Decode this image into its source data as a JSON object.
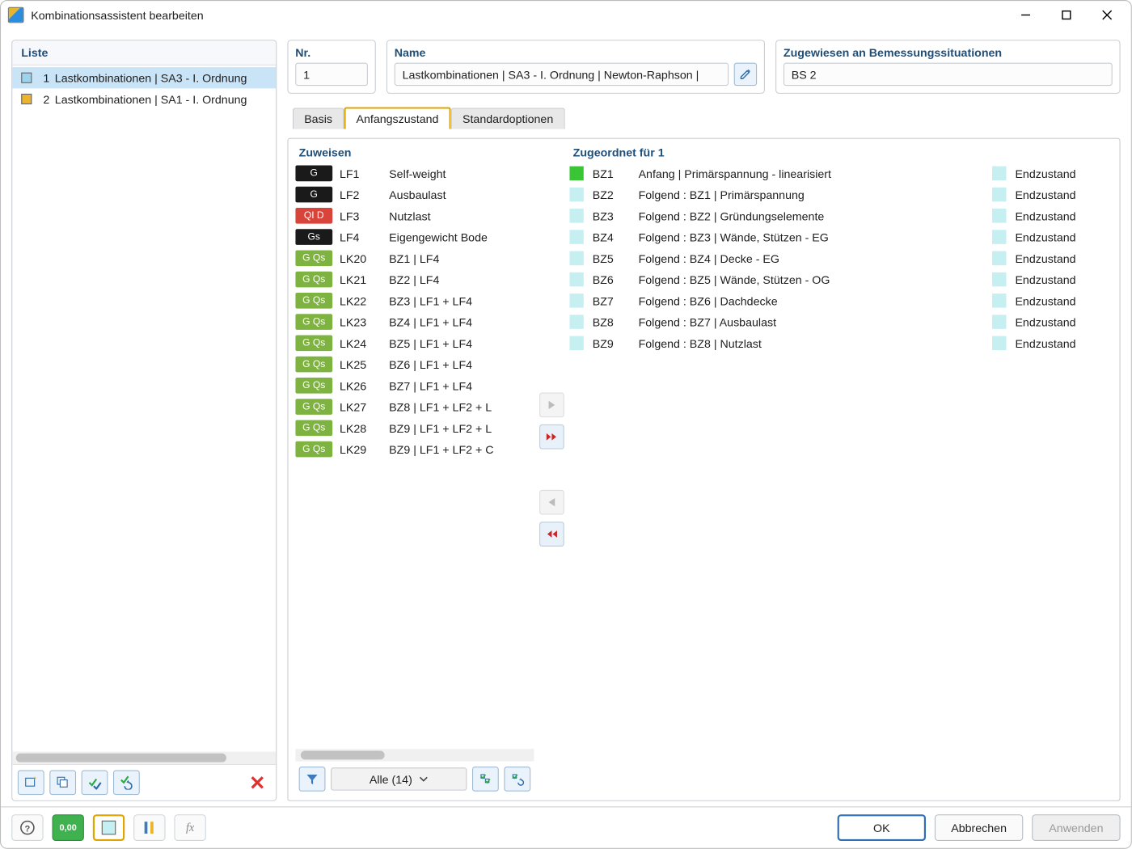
{
  "window": {
    "title": "Kombinationsassistent bearbeiten"
  },
  "listPanel": {
    "header": "Liste",
    "items": [
      {
        "idx": "1",
        "text": "Lastkombinationen | SA3 - I. Ordnung",
        "color": "#9cd4f0",
        "selected": true
      },
      {
        "idx": "2",
        "text": "Lastkombinationen | SA1 - I. Ordnung",
        "color": "#ecb42b",
        "selected": false
      }
    ]
  },
  "fields": {
    "nr": {
      "label": "Nr.",
      "value": "1"
    },
    "name": {
      "label": "Name",
      "value": "Lastkombinationen | SA3 - I. Ordnung | Newton-Raphson |"
    },
    "assigned": {
      "label": "Zugewiesen an Bemessungssituationen",
      "value": "BS 2"
    }
  },
  "tabs": {
    "items": [
      "Basis",
      "Anfangszustand",
      "Standardoptionen"
    ],
    "activeIndex": 1
  },
  "assignPanel": {
    "header": "Zuweisen",
    "rows": [
      {
        "tag": "G",
        "tagClass": "black",
        "code": "LF1",
        "desc": "Self-weight"
      },
      {
        "tag": "G",
        "tagClass": "black",
        "code": "LF2",
        "desc": "Ausbaulast"
      },
      {
        "tag": "QI D",
        "tagClass": "red",
        "code": "LF3",
        "desc": "Nutzlast"
      },
      {
        "tag": "Gs",
        "tagClass": "black",
        "code": "LF4",
        "desc": "Eigengewicht Bode"
      },
      {
        "tag": "G Qs",
        "tagClass": "green",
        "code": "LK20",
        "desc": "BZ1 | LF4"
      },
      {
        "tag": "G Qs",
        "tagClass": "green",
        "code": "LK21",
        "desc": "BZ2 | LF4"
      },
      {
        "tag": "G Qs",
        "tagClass": "green",
        "code": "LK22",
        "desc": "BZ3 | LF1 + LF4"
      },
      {
        "tag": "G Qs",
        "tagClass": "green",
        "code": "LK23",
        "desc": "BZ4 | LF1 + LF4"
      },
      {
        "tag": "G Qs",
        "tagClass": "green",
        "code": "LK24",
        "desc": "BZ5 | LF1 + LF4"
      },
      {
        "tag": "G Qs",
        "tagClass": "green",
        "code": "LK25",
        "desc": "BZ6 | LF1 + LF4"
      },
      {
        "tag": "G Qs",
        "tagClass": "green",
        "code": "LK26",
        "desc": "BZ7 | LF1 + LF4"
      },
      {
        "tag": "G Qs",
        "tagClass": "green",
        "code": "LK27",
        "desc": "BZ8 | LF1 + LF2 + L"
      },
      {
        "tag": "G Qs",
        "tagClass": "green",
        "code": "LK28",
        "desc": "BZ9 | LF1 + LF2 + L"
      },
      {
        "tag": "G Qs",
        "tagClass": "green",
        "code": "LK29",
        "desc": "BZ9 | LF1 + LF2 + C"
      }
    ],
    "filter": {
      "text": "Alle (14)"
    }
  },
  "assignedPanel": {
    "header": "Zugeordnet für 1",
    "rows": [
      {
        "bz": "BZ1",
        "desc": "Anfang | Primärspannung - linearisiert",
        "end": "Endzustand",
        "color": "green"
      },
      {
        "bz": "BZ2",
        "desc": "Folgend : BZ1 | Primärspannung",
        "end": "Endzustand",
        "color": "lblue"
      },
      {
        "bz": "BZ3",
        "desc": "Folgend : BZ2 | Gründungselemente",
        "end": "Endzustand",
        "color": "lblue"
      },
      {
        "bz": "BZ4",
        "desc": "Folgend : BZ3 | Wände, Stützen - EG",
        "end": "Endzustand",
        "color": "lblue"
      },
      {
        "bz": "BZ5",
        "desc": "Folgend : BZ4 | Decke - EG",
        "end": "Endzustand",
        "color": "lblue"
      },
      {
        "bz": "BZ6",
        "desc": "Folgend : BZ5 | Wände, Stützen - OG",
        "end": "Endzustand",
        "color": "lblue"
      },
      {
        "bz": "BZ7",
        "desc": "Folgend : BZ6 | Dachdecke",
        "end": "Endzustand",
        "color": "lblue"
      },
      {
        "bz": "BZ8",
        "desc": "Folgend : BZ7 | Ausbaulast",
        "end": "Endzustand",
        "color": "lblue"
      },
      {
        "bz": "BZ9",
        "desc": "Folgend : BZ8 | Nutzlast",
        "end": "Endzustand",
        "color": "lblue"
      }
    ]
  },
  "footer": {
    "ok": "OK",
    "cancel": "Abbrechen",
    "apply": "Anwenden"
  }
}
